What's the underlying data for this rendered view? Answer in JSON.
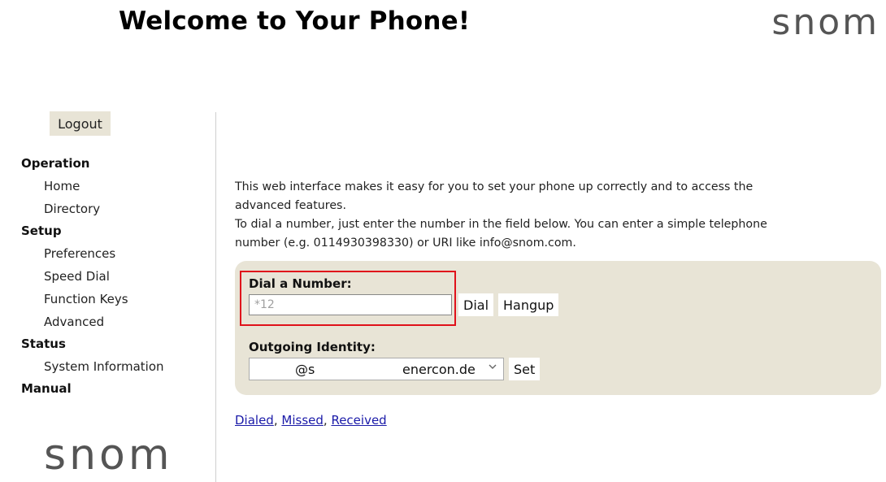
{
  "header": {
    "title": "Welcome to Your Phone!",
    "brand": "snom"
  },
  "sidebar": {
    "logout_label": "Logout",
    "groups": [
      {
        "label": "Operation",
        "items": [
          "Home",
          "Directory"
        ]
      },
      {
        "label": "Setup",
        "items": [
          "Preferences",
          "Speed Dial",
          "Function Keys",
          "Advanced"
        ]
      },
      {
        "label": "Status",
        "items": [
          "System Information"
        ]
      },
      {
        "label": "Manual",
        "items": []
      }
    ],
    "brand": "snom"
  },
  "main": {
    "intro_line1": "This web interface makes it easy for you to set your phone up correctly and to access the",
    "intro_line2": "advanced features.",
    "intro_line3": "To dial a number, just enter the number in the field below. You can enter a simple telephone",
    "intro_line4": "number (e.g. 0114930398330) or URI like info@snom.com.",
    "dial": {
      "label": "Dial a Number:",
      "placeholder": "*12",
      "dial_button": "Dial",
      "hangup_button": "Hangup"
    },
    "identity": {
      "label": "Outgoing Identity:",
      "value_at": "@s",
      "value_domain": "enercon.de",
      "set_button": "Set"
    },
    "links": {
      "dialed": "Dialed",
      "missed": "Missed",
      "received": "Received",
      "separator": ","
    }
  },
  "colors": {
    "panel": "#e8e4d6",
    "highlight": "#e0121b",
    "link": "#1a1aa8"
  }
}
